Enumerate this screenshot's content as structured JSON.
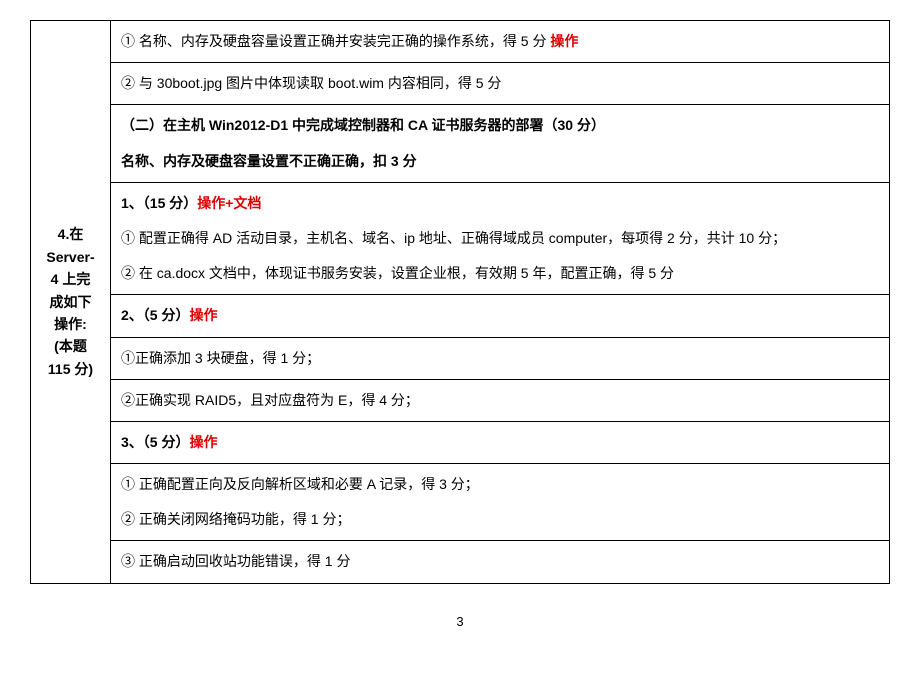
{
  "left": {
    "header_line1": "4.在",
    "header_line2": "Server-",
    "header_line3": "4 上完",
    "header_line4": "成如下",
    "header_line5": "操作:",
    "header_line6": "(本题",
    "header_line7": "115 分)"
  },
  "r1": {
    "prefix": "①  名称、内存及硬盘容量设置正确并安装完正确的操作系统，得 5 分  ",
    "red": "操作"
  },
  "r2": {
    "text": "②  与 30boot.jpg 图片中体现读取 boot.wim 内容相同，得 5 分"
  },
  "r3": {
    "text": "（二）在主机 Win2012-D1 中完成域控制器和 CA 证书服务器的部署（30 分）"
  },
  "r4": {
    "text": "名称、内存及硬盘容量设置不正确正确，扣 3 分"
  },
  "r5": {
    "prefix": "1、（15 分）",
    "red": "操作+文档"
  },
  "r6": {
    "text": "①  配置正确得 AD 活动目录，主机名、域名、ip 地址、正确得域成员 computer，每项得 2 分，共计 10 分；"
  },
  "r7": {
    "text": "②  在 ca.docx 文档中，体现证书服务安装，设置企业根，有效期 5 年，配置正确，得 5 分"
  },
  "r8": {
    "prefix": "2、（5 分）",
    "red": "操作"
  },
  "r9": {
    "text": "①正确添加 3 块硬盘，得 1 分；"
  },
  "r10": {
    "text": "②正确实现 RAID5，且对应盘符为 E，得 4 分；"
  },
  "r11": {
    "prefix": "3、（5 分）",
    "red": "操作"
  },
  "r12": {
    "text": "①  正确配置正向及反向解析区域和必要 A 记录，得 3 分；"
  },
  "r13": {
    "text": "②  正确关闭网络掩码功能，得 1 分；"
  },
  "r14": {
    "text": "③  正确启动回收站功能错误，得 1 分"
  },
  "page_num": "3"
}
